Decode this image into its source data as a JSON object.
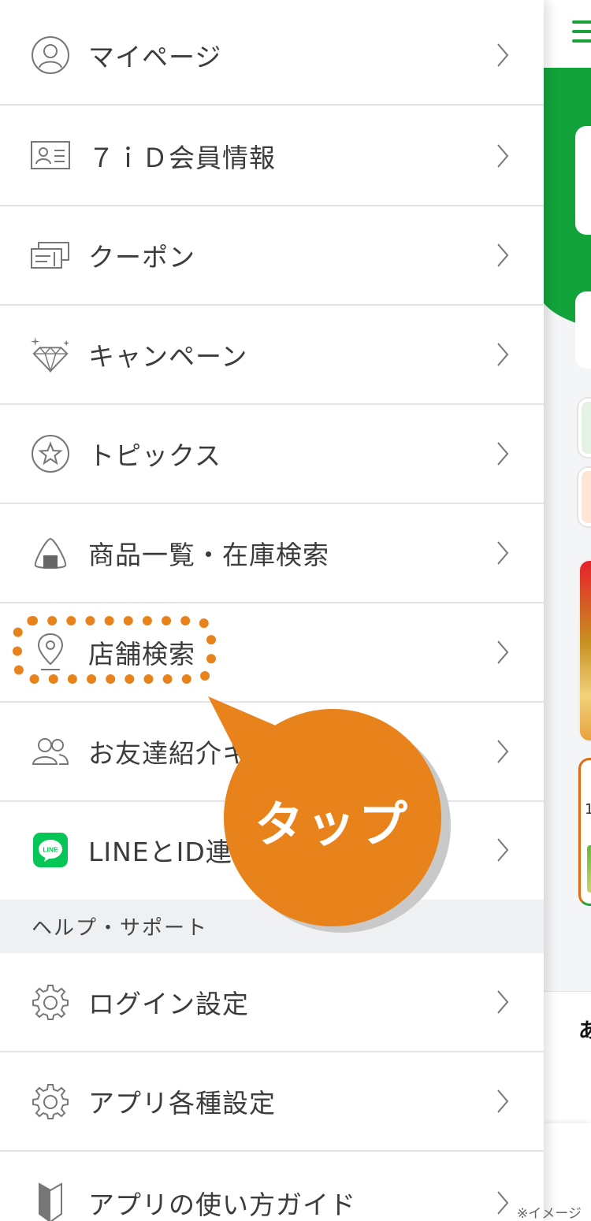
{
  "menu": {
    "items": [
      {
        "label": "マイページ",
        "icon": "person-icon"
      },
      {
        "label": "７ｉＤ会員情報",
        "icon": "id-card-icon"
      },
      {
        "label": "クーポン",
        "icon": "coupon-icon"
      },
      {
        "label": "キャンペーン",
        "icon": "diamond-icon"
      },
      {
        "label": "トピックス",
        "icon": "star-icon"
      },
      {
        "label": "商品一覧・在庫検索",
        "icon": "onigiri-icon"
      },
      {
        "label": "店舗検索",
        "icon": "map-pin-icon"
      },
      {
        "label": "お友達紹介キ",
        "icon": "friends-icon"
      },
      {
        "label": "LINEとID連携",
        "icon": "line-icon"
      }
    ],
    "help_section_title": "ヘルプ・サポート",
    "help_items": [
      {
        "label": "ログイン設定",
        "icon": "gear-icon"
      },
      {
        "label": "アプリ各種設定",
        "icon": "gear-icon"
      },
      {
        "label": "アプリの使い方ガイド",
        "icon": "beginner-mark-icon"
      }
    ]
  },
  "annotation": {
    "bubble_text": "タップ",
    "highlight_color": "#e8831c",
    "note": "※イメージ"
  },
  "background_app": {
    "partial_text": "あ",
    "partial_number": "1",
    "accent": "#12a33a"
  }
}
